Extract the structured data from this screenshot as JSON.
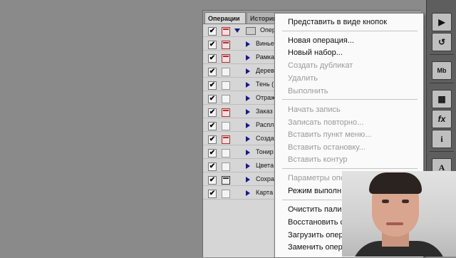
{
  "panel": {
    "tabs": [
      "Операции",
      "История"
    ],
    "folder_label": "Опер",
    "rows": [
      {
        "label": "Винье",
        "dialog": "on"
      },
      {
        "label": "Рамка",
        "dialog": "on"
      },
      {
        "label": "Дерев",
        "dialog": "off"
      },
      {
        "label": "Тень (",
        "dialog": "off"
      },
      {
        "label": "Отраж",
        "dialog": "off"
      },
      {
        "label": "Заказ",
        "dialog": "on"
      },
      {
        "label": "Распл",
        "dialog": "off"
      },
      {
        "label": "Созда",
        "dialog": "on"
      },
      {
        "label": "Тонир",
        "dialog": "off"
      },
      {
        "label": "Цвета",
        "dialog": "off"
      },
      {
        "label": "Сохра",
        "dialog": "dark"
      },
      {
        "label": "Карта",
        "dialog": "off"
      }
    ],
    "check_mark": "✔"
  },
  "menu": {
    "items": [
      {
        "label": "Представить в виде кнопок",
        "enabled": true
      },
      {
        "label": "Новая операция...",
        "enabled": true
      },
      {
        "label": "Новый набор...",
        "enabled": true
      },
      {
        "label": "Создать дубликат",
        "enabled": false
      },
      {
        "label": "Удалить",
        "enabled": false
      },
      {
        "label": "Выполнить",
        "enabled": false
      },
      {
        "label": "Начать запись",
        "enabled": false
      },
      {
        "label": "Записать повторно...",
        "enabled": false
      },
      {
        "label": "Вставить пункт меню...",
        "enabled": false
      },
      {
        "label": "Вставить остановку...",
        "enabled": false
      },
      {
        "label": "Вставить контур",
        "enabled": false
      },
      {
        "label": "Параметры опе",
        "enabled": false
      },
      {
        "label": "Режим выполн",
        "enabled": true
      },
      {
        "label": "Очистить пали",
        "enabled": true
      },
      {
        "label": "Восстановить с",
        "enabled": true
      },
      {
        "label": "Загрузить опер",
        "enabled": true
      },
      {
        "label": "Заменить опера",
        "enabled": true
      }
    ]
  },
  "dock": {
    "buttons": [
      {
        "icon": "play-icon",
        "glyph": "▶"
      },
      {
        "icon": "history-brush-icon",
        "glyph": "↺"
      },
      {
        "icon": "mini-bridge-icon",
        "glyph": "Mb"
      },
      {
        "icon": "grid-icon",
        "glyph": "▦"
      },
      {
        "icon": "fx-icon",
        "glyph": "fx"
      },
      {
        "icon": "info-icon",
        "glyph": "i"
      },
      {
        "icon": "character-icon",
        "glyph": "A"
      }
    ]
  }
}
